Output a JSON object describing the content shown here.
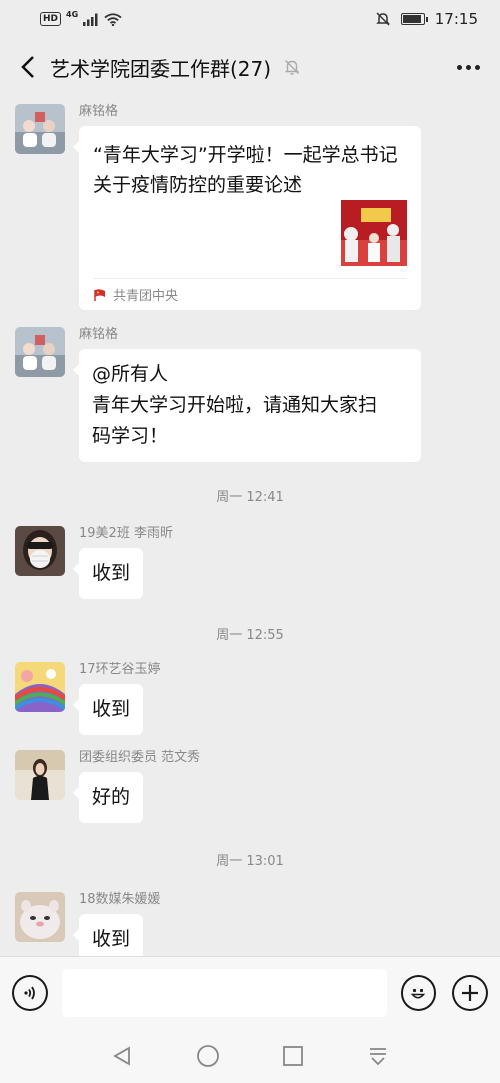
{
  "status_bar": {
    "hd": "HD",
    "network": "4G",
    "time": "17:15"
  },
  "header": {
    "title": "艺术学院团委工作群(27)"
  },
  "messages": [
    {
      "sender": "麻铭格",
      "card": {
        "title": "“青年大学习”开学啦！一起学总书记关于疫情防控的重要论述",
        "source": "共青团中央"
      }
    },
    {
      "sender": "麻铭格",
      "lines": [
        "@所有人",
        "青年大学习开始啦，请通知大家扫",
        "码学习！"
      ]
    },
    {
      "timestamp": "周一 12:41"
    },
    {
      "sender": "19美2班 李雨昕",
      "text": "收到"
    },
    {
      "timestamp": "周一 12:55"
    },
    {
      "sender": "17环艺谷玉婷",
      "text": "收到"
    },
    {
      "sender": "团委组织委员 范文秀",
      "text": "好的"
    },
    {
      "timestamp": "周一 13:01"
    },
    {
      "sender": "18数媒朱媛媛",
      "text": "收到"
    }
  ],
  "icons": {
    "back": "back-arrow-icon",
    "mute": "bell-off-icon",
    "more": "more-dots-icon",
    "voice": "voice-icon",
    "emoji": "emoji-icon",
    "plus": "plus-icon",
    "nav_back": "triangle-back-icon",
    "nav_home": "circle-home-icon",
    "nav_recent": "square-recent-icon",
    "nav_down": "download-icon"
  },
  "colors": {
    "background": "#ededed",
    "bubble": "#ffffff",
    "meta_text": "#888888"
  }
}
